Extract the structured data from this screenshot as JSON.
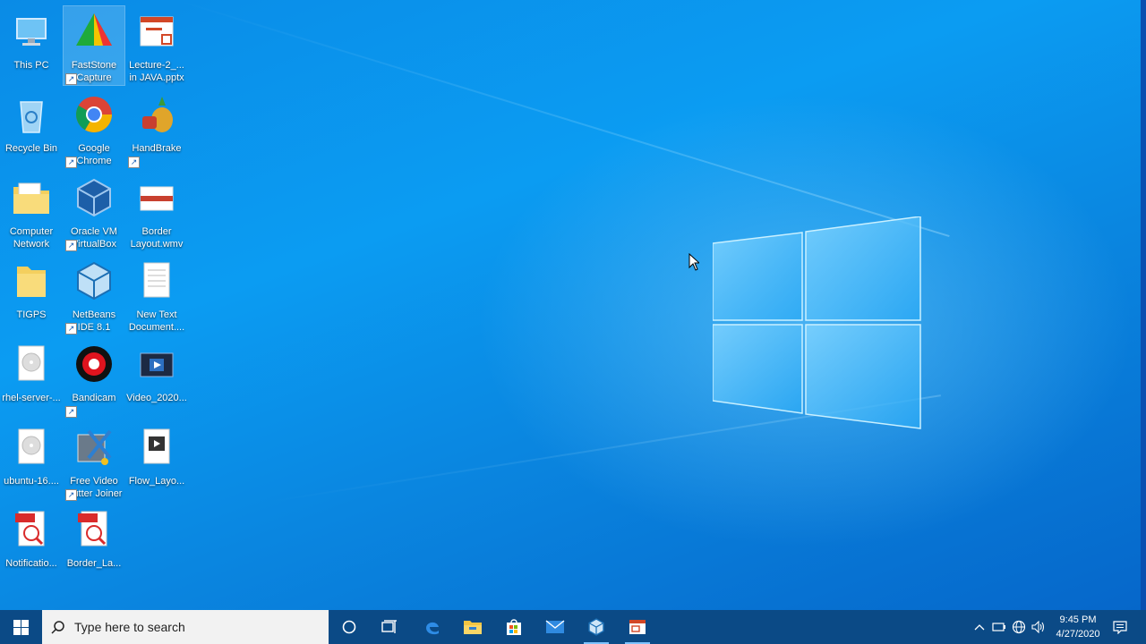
{
  "desktop": {
    "icons": [
      {
        "label": "This PC",
        "icon": "this-pc-icon"
      },
      {
        "label": "FastStone Capture",
        "icon": "faststone-capture-icon"
      },
      {
        "label": "Lecture-2_... in JAVA.pptx",
        "icon": "pptx-file-icon"
      },
      {
        "label": "Recycle Bin",
        "icon": "recycle-bin-icon"
      },
      {
        "label": "Google Chrome",
        "icon": "chrome-icon"
      },
      {
        "label": "HandBrake",
        "icon": "handbrake-icon"
      },
      {
        "label": "Computer Network",
        "icon": "folder-docs-icon"
      },
      {
        "label": "Oracle VM VirtualBox",
        "icon": "virtualbox-icon"
      },
      {
        "label": "Border Layout.wmv",
        "icon": "wmv-file-icon"
      },
      {
        "label": "TIGPS",
        "icon": "folder-icon"
      },
      {
        "label": "NetBeans IDE 8.1",
        "icon": "netbeans-icon"
      },
      {
        "label": "New Text Document....",
        "icon": "text-file-icon"
      },
      {
        "label": "rhel-server-...",
        "icon": "disc-image-icon"
      },
      {
        "label": "Bandicam",
        "icon": "bandicam-icon"
      },
      {
        "label": "Video_2020...",
        "icon": "video-file-icon"
      },
      {
        "label": "ubuntu-16....",
        "icon": "disc-image-icon"
      },
      {
        "label": "Free Video Cutter Joiner",
        "icon": "video-cutter-icon"
      },
      {
        "label": "Flow_Layo...",
        "icon": "video-file-icon"
      },
      {
        "label": "Notificatio...",
        "icon": "pdf-file-icon"
      },
      {
        "label": "Border_La...",
        "icon": "pdf-file-icon"
      }
    ],
    "selected": "FastStone Capture"
  },
  "taskbar": {
    "search_placeholder": "Type here to search",
    "pinned": [
      "start-icon",
      "cortana-icon",
      "task-view-icon",
      "edge-icon",
      "file-explorer-icon",
      "store-icon",
      "mail-icon",
      "netbeans-icon",
      "powerpoint-icon"
    ],
    "running": [
      "netbeans-icon",
      "powerpoint-icon"
    ],
    "tray": {
      "time": "9:45 PM",
      "date": "4/27/2020"
    }
  },
  "colors": {
    "desktop_accent": "#0a8be6",
    "taskbar": "#0b4a86",
    "search_box": "#f2f2f2"
  }
}
